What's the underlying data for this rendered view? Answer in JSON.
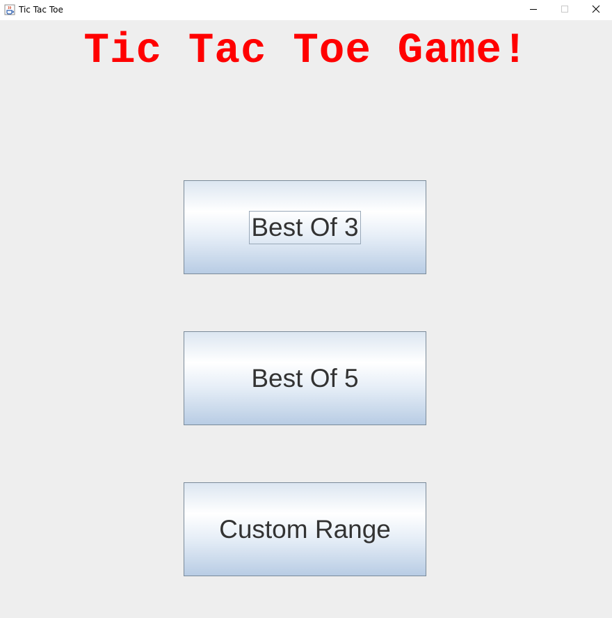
{
  "window": {
    "title": "Tic Tac Toe"
  },
  "game": {
    "heading": "Tic Tac Toe Game!",
    "heading_color": "#ff0000"
  },
  "menu": {
    "best_of_3": "Best Of 3",
    "best_of_5": "Best Of 5",
    "custom_range": "Custom Range",
    "focused_option": "Best Of 3"
  },
  "icons": {
    "app": "java-cup-icon",
    "minimize": "minimize-icon",
    "maximize": "maximize-icon",
    "close": "close-icon"
  }
}
